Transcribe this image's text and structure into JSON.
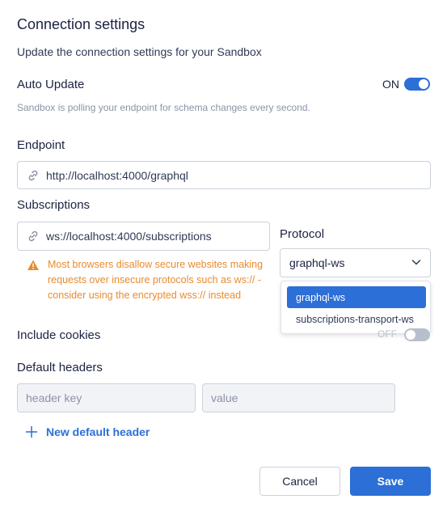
{
  "dialog": {
    "title": "Connection settings",
    "subtitle": "Update the connection settings for your Sandbox"
  },
  "auto_update": {
    "label": "Auto Update",
    "state_text": "ON",
    "hint": "Sandbox is polling your endpoint for schema changes every second."
  },
  "endpoint": {
    "label": "Endpoint",
    "value": "http://localhost:4000/graphql"
  },
  "subscriptions": {
    "label": "Subscriptions",
    "value": "ws://localhost:4000/subscriptions",
    "warning": "Most browsers disallow secure websites making requests over insecure protocols such as ws:// - consider using the encrypted wss:// instead"
  },
  "protocol": {
    "label": "Protocol",
    "selected": "graphql-ws",
    "options": [
      "graphql-ws",
      "subscriptions-transport-ws"
    ]
  },
  "include_cookies": {
    "label": "Include cookies",
    "state_text": "OFF"
  },
  "default_headers": {
    "label": "Default headers",
    "key_placeholder": "header key",
    "value_placeholder": "value",
    "new_label": "New default header"
  },
  "actions": {
    "cancel": "Cancel",
    "save": "Save"
  },
  "colors": {
    "accent": "#2c6fd6",
    "warning": "#e98b2e",
    "text": "#1b2240",
    "muted": "#8b93a6"
  }
}
